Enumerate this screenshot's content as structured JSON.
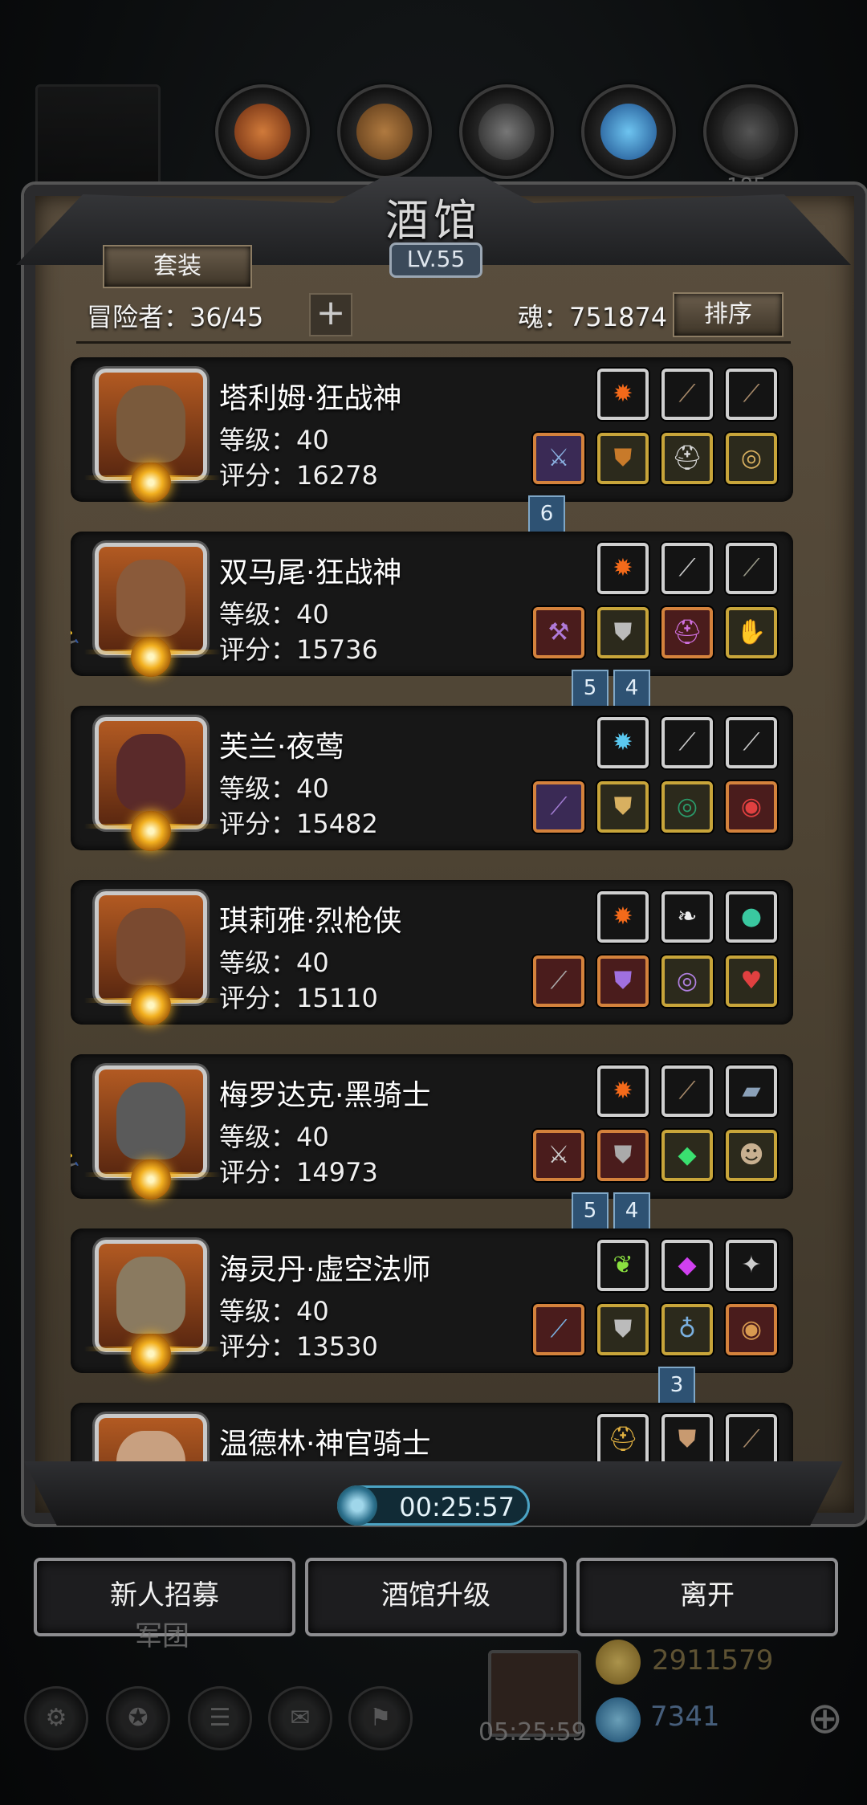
{
  "title": "酒馆",
  "level_badge": "LV.55",
  "outfit_button": "套装",
  "adventurers_label": "冒险者：36/45",
  "add_label": "+",
  "soul_label": "魂：751874",
  "sort_button": "排序",
  "top_number": "185",
  "heroes": [
    {
      "name": "塔利姆·狂战神",
      "level": "等级：40",
      "score": "评分：16278",
      "face": "#7a5a3c"
    },
    {
      "name": "双马尾·狂战神",
      "level": "等级：40",
      "score": "评分：15736",
      "face": "#8a5a3a"
    },
    {
      "name": "芙兰·夜莺",
      "level": "等级：40",
      "score": "评分：15482",
      "face": "#5a2a2a"
    },
    {
      "name": "琪莉雅·烈枪侠",
      "level": "等级：40",
      "score": "评分：15110",
      "face": "#7a4a30"
    },
    {
      "name": "梅罗达克·黑骑士",
      "level": "等级：40",
      "score": "评分：14973",
      "face": "#5a5a5a"
    },
    {
      "name": "海灵丹·虚空法师",
      "level": "等级：40",
      "score": "评分：13530",
      "face": "#8a7a60"
    },
    {
      "name": "温德林·神官骑士",
      "level": "",
      "score": "",
      "face": "#c8a080"
    }
  ],
  "tags": {
    "t1": "6",
    "t2a": "5",
    "t2b": "4",
    "t5a": "5",
    "t5b": "4",
    "t6": "3"
  },
  "timer": "00:25:57",
  "buttons": {
    "recruit": "新人招募",
    "upgrade": "酒馆升级",
    "leave": "离开"
  },
  "bottom": {
    "gift_timer": "05:25:59",
    "gold": "2911579",
    "gems": "7341",
    "under_text": "军团"
  },
  "colors": {
    "accent": "#4ba3c4",
    "gold": "#f5b422",
    "panel": "#4d4333"
  }
}
